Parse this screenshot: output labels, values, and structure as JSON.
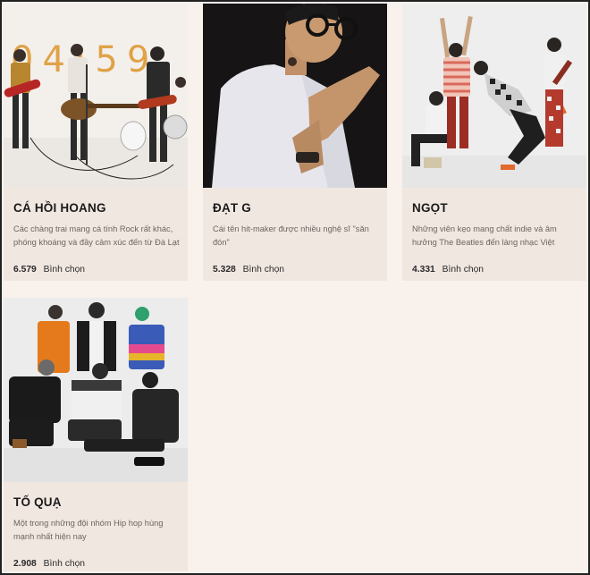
{
  "cards": [
    {
      "name": "CÁ HỒI HOANG",
      "description": "Các chàng trai mang cá tính Rock rất khác, phóng khoáng và đầy cảm xúc đến từ Đà Lạt",
      "votes": "6.579",
      "votes_label": "Bình chọn",
      "photo_text": "04:59"
    },
    {
      "name": "ĐẠT G",
      "description": "Cái tên hit-maker được nhiều nghệ sĩ \"săn đón\"",
      "votes": "5.328",
      "votes_label": "Bình chọn"
    },
    {
      "name": "NGỌT",
      "description": "Những viên kẹo mang chất indie và âm hưởng The Beatles đến làng nhạc Việt",
      "votes": "4.331",
      "votes_label": "Bình chọn"
    },
    {
      "name": "TỐ QUẠ",
      "description": "Một trong những đội nhóm Hip hop hùng mạnh nhất hiện nay",
      "votes": "2.908",
      "votes_label": "Bình chọn"
    }
  ]
}
